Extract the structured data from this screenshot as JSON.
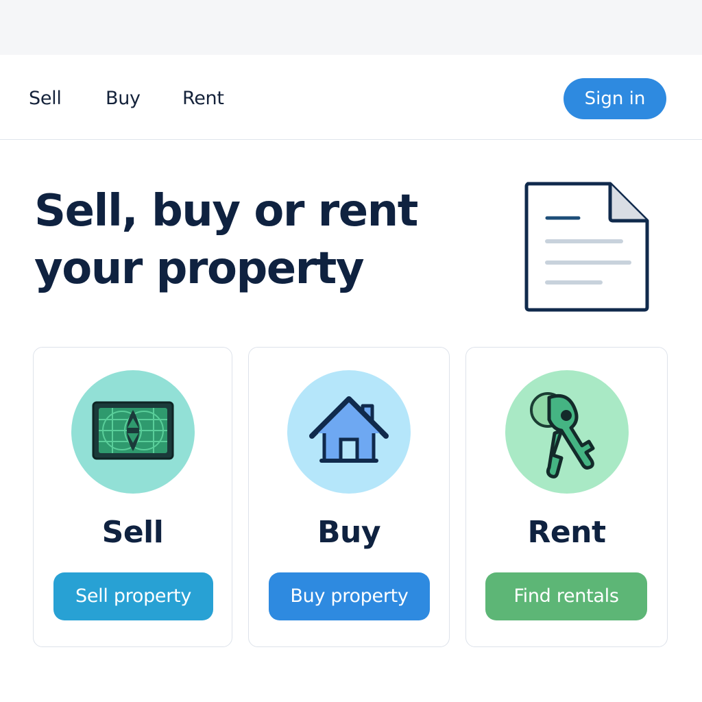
{
  "nav": {
    "links": [
      {
        "label": "Sell"
      },
      {
        "label": "Buy"
      },
      {
        "label": "Rent"
      }
    ],
    "sign_in_label": "Sign in"
  },
  "hero": {
    "title_line_1": "Sell, buy or rent",
    "title_line_2": "your property",
    "illustration_icon": "document-icon"
  },
  "cards": [
    {
      "title": "Sell",
      "button_label": "Sell property",
      "icon": "money-bill-icon",
      "circle_color": "#92e0d6",
      "button_color": "#28a1d4"
    },
    {
      "title": "Buy",
      "button_label": "Buy property",
      "icon": "house-icon",
      "circle_color": "#b5e6fa",
      "button_color": "#2e8ae0"
    },
    {
      "title": "Rent",
      "button_label": "Find rentals",
      "icon": "keys-icon",
      "circle_color": "#a9e9c5",
      "button_color": "#5db676"
    }
  ],
  "colors": {
    "brand_blue": "#2e8ae0",
    "heading_navy": "#0f2240",
    "top_strip": "#f5f6f8"
  }
}
